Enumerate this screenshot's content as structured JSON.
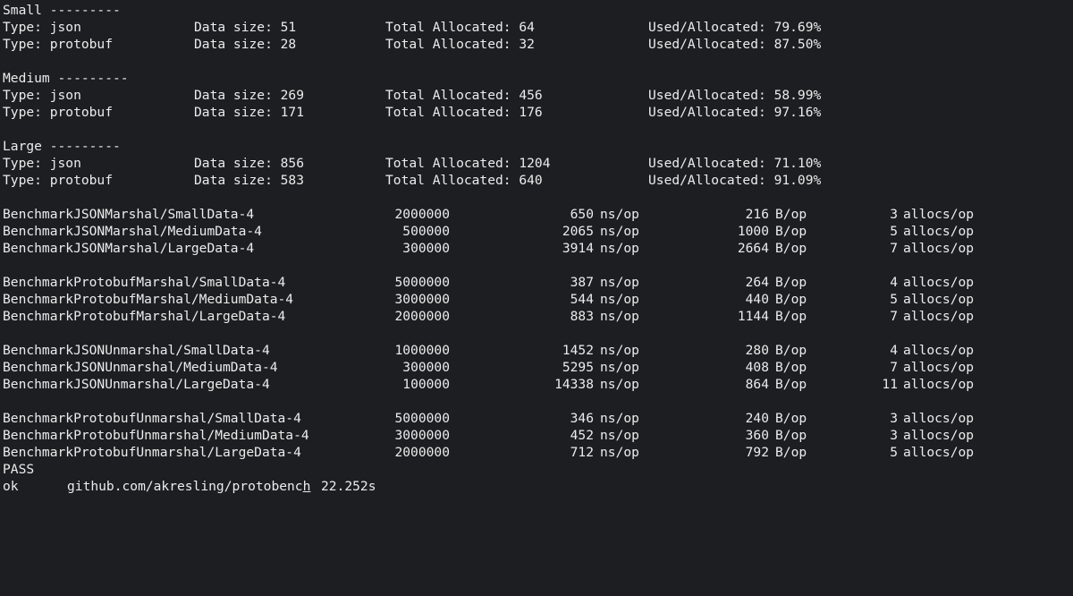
{
  "theme": {
    "background": "#1d1e21",
    "text": "#ececec"
  },
  "sections": [
    {
      "header": "Small ---------",
      "rows": [
        {
          "type": "Type: json",
          "size": "Data size: 51",
          "alloc": "Total Allocated: 64",
          "ratio": "Used/Allocated: 79.69%"
        },
        {
          "type": "Type: protobuf",
          "size": "Data size: 28",
          "alloc": "Total Allocated: 32",
          "ratio": "Used/Allocated: 87.50%"
        }
      ]
    },
    {
      "header": "Medium ---------",
      "rows": [
        {
          "type": "Type: json",
          "size": "Data size: 269",
          "alloc": "Total Allocated: 456",
          "ratio": "Used/Allocated: 58.99%"
        },
        {
          "type": "Type: protobuf",
          "size": "Data size: 171",
          "alloc": "Total Allocated: 176",
          "ratio": "Used/Allocated: 97.16%"
        }
      ]
    },
    {
      "header": "Large ---------",
      "rows": [
        {
          "type": "Type: json",
          "size": "Data size: 856",
          "alloc": "Total Allocated: 1204",
          "ratio": "Used/Allocated: 71.10%"
        },
        {
          "type": "Type: protobuf",
          "size": "Data size: 583",
          "alloc": "Total Allocated: 640",
          "ratio": "Used/Allocated: 91.09%"
        }
      ]
    }
  ],
  "benchmarks": [
    [
      {
        "name": "BenchmarkJSONMarshal/SmallData-4",
        "iters": "2000000",
        "ns": "650",
        "ns_unit": "ns/op",
        "bytes": "216",
        "b_unit": "B/op",
        "allocs": "3",
        "a_unit": "allocs/op"
      },
      {
        "name": "BenchmarkJSONMarshal/MediumData-4",
        "iters": "500000",
        "ns": "2065",
        "ns_unit": "ns/op",
        "bytes": "1000",
        "b_unit": "B/op",
        "allocs": "5",
        "a_unit": "allocs/op"
      },
      {
        "name": "BenchmarkJSONMarshal/LargeData-4",
        "iters": "300000",
        "ns": "3914",
        "ns_unit": "ns/op",
        "bytes": "2664",
        "b_unit": "B/op",
        "allocs": "7",
        "a_unit": "allocs/op"
      }
    ],
    [
      {
        "name": "BenchmarkProtobufMarshal/SmallData-4",
        "iters": "5000000",
        "ns": "387",
        "ns_unit": "ns/op",
        "bytes": "264",
        "b_unit": "B/op",
        "allocs": "4",
        "a_unit": "allocs/op"
      },
      {
        "name": "BenchmarkProtobufMarshal/MediumData-4",
        "iters": "3000000",
        "ns": "544",
        "ns_unit": "ns/op",
        "bytes": "440",
        "b_unit": "B/op",
        "allocs": "5",
        "a_unit": "allocs/op"
      },
      {
        "name": "BenchmarkProtobufMarshal/LargeData-4",
        "iters": "2000000",
        "ns": "883",
        "ns_unit": "ns/op",
        "bytes": "1144",
        "b_unit": "B/op",
        "allocs": "7",
        "a_unit": "allocs/op"
      }
    ],
    [
      {
        "name": "BenchmarkJSONUnmarshal/SmallData-4",
        "iters": "1000000",
        "ns": "1452",
        "ns_unit": "ns/op",
        "bytes": "280",
        "b_unit": "B/op",
        "allocs": "4",
        "a_unit": "allocs/op"
      },
      {
        "name": "BenchmarkJSONUnmarshal/MediumData-4",
        "iters": "300000",
        "ns": "5295",
        "ns_unit": "ns/op",
        "bytes": "408",
        "b_unit": "B/op",
        "allocs": "7",
        "a_unit": "allocs/op"
      },
      {
        "name": "BenchmarkJSONUnmarshal/LargeData-4",
        "iters": "100000",
        "ns": "14338",
        "ns_unit": "ns/op",
        "bytes": "864",
        "b_unit": "B/op",
        "allocs": "11",
        "a_unit": "allocs/op"
      }
    ],
    [
      {
        "name": "BenchmarkProtobufUnmarshal/SmallData-4",
        "iters": "5000000",
        "ns": "346",
        "ns_unit": "ns/op",
        "bytes": "240",
        "b_unit": "B/op",
        "allocs": "3",
        "a_unit": "allocs/op"
      },
      {
        "name": "BenchmarkProtobufUnmarshal/MediumData-4",
        "iters": "3000000",
        "ns": "452",
        "ns_unit": "ns/op",
        "bytes": "360",
        "b_unit": "B/op",
        "allocs": "3",
        "a_unit": "allocs/op"
      },
      {
        "name": "BenchmarkProtobufUnmarshal/LargeData-4",
        "iters": "2000000",
        "ns": "712",
        "ns_unit": "ns/op",
        "bytes": "792",
        "b_unit": "B/op",
        "allocs": "5",
        "a_unit": "allocs/op"
      }
    ]
  ],
  "footer": {
    "pass": "PASS",
    "ok": "ok",
    "package_pre": "github.com/akresling/protobenc",
    "package_cursor_char": "h",
    "duration": "22.252s"
  }
}
